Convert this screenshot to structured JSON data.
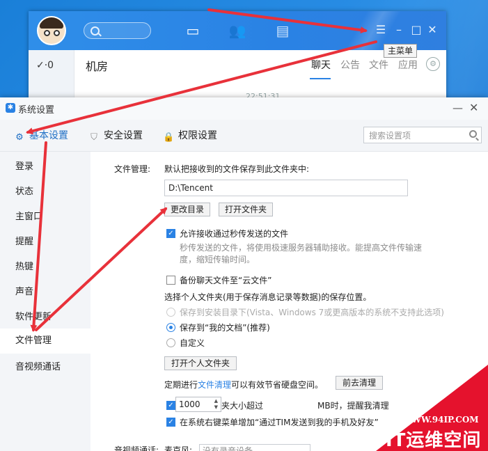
{
  "tim": {
    "stat": "✓·0",
    "room": "机房",
    "tabs": [
      "聊天",
      "公告",
      "文件",
      "应用"
    ],
    "time": "22:51:31",
    "tooltip": "主菜单"
  },
  "settings": {
    "title": "系统设置",
    "tabs": [
      "基本设置",
      "安全设置",
      "权限设置"
    ],
    "search_placeholder": "搜索设置项",
    "sidebar": [
      "登录",
      "状态",
      "主窗口",
      "提醒",
      "热键",
      "声音",
      "软件更新",
      "文件管理",
      "音视频通话"
    ],
    "file": {
      "label": "文件管理:",
      "desc": "默认把接收到的文件保存到此文件夹中:",
      "path": "D:\\Tencent",
      "change_dir": "更改目录",
      "open_folder": "打开文件夹",
      "allow_fast": "允许接收通过秒传发送的文件",
      "fast_desc1": "秒传发送的文件，将使用极速服务器辅助接收。能提高文件传输速",
      "fast_desc2": "度，缩短传输时间。",
      "backup": "备份聊天文件至“云文件”",
      "choose_loc": "选择个人文件夹(用于保存消息记录等数据)的保存位置。",
      "opt_install": "保存到安装目录下(Vista、Windows 7或更高版本的系统不支持此选项)",
      "opt_docs": "保存到“我的文档”(推荐)",
      "opt_custom": "自定义",
      "open_personal": "打开个人文件夹",
      "clean_pre": "定期进行",
      "clean_link": "文件清理",
      "clean_post": "可以有效节省硬盘空间。",
      "go_clean": "前去清理",
      "size_pre": "当个人文件夹大小超过",
      "size_val": "1000",
      "size_post": "MB时，提醒我清理",
      "context": "在系统右键菜单增加“通过TIM发送到我的手机及好友”",
      "av_label": "音视频通话:",
      "mic_label": "麦克风:",
      "mic_val": "没有录音设备"
    }
  },
  "watermark": {
    "url": "WWW.94IP.COM",
    "title": "IT运维空间"
  },
  "colors": {
    "accent": "#2a82e4",
    "arrow": "#e8313a",
    "watermark": "#e5122d"
  }
}
